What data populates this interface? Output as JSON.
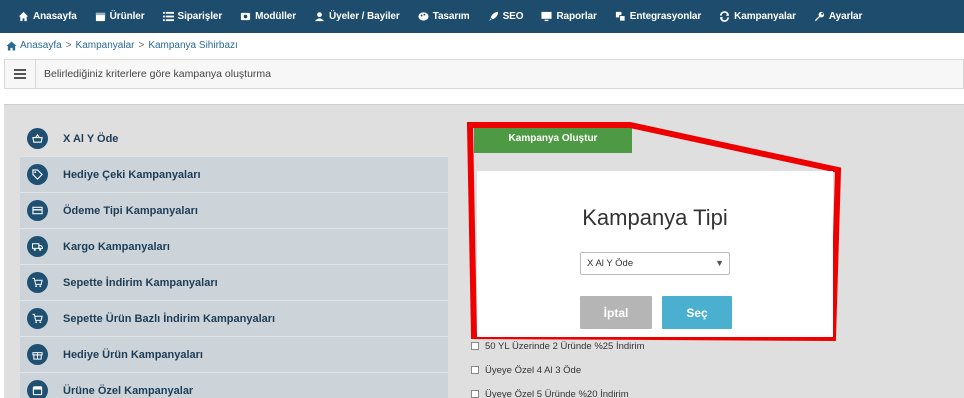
{
  "nav": {
    "items": [
      {
        "label": "Anasayfa",
        "icon": "home-icon"
      },
      {
        "label": "Ürünler",
        "icon": "box-icon"
      },
      {
        "label": "Siparişler",
        "icon": "list-icon"
      },
      {
        "label": "Modüller",
        "icon": "modules-icon"
      },
      {
        "label": "Üyeler / Bayiler",
        "icon": "user-icon"
      },
      {
        "label": "Tasarım",
        "icon": "palette-icon"
      },
      {
        "label": "SEO",
        "icon": "rocket-icon"
      },
      {
        "label": "Raporlar",
        "icon": "monitor-icon"
      },
      {
        "label": "Entegrasyonlar",
        "icon": "integration-icon"
      },
      {
        "label": "Kampanyalar",
        "icon": "refresh-icon"
      },
      {
        "label": "Ayarlar",
        "icon": "wrench-icon"
      }
    ]
  },
  "breadcrumb": {
    "home": "Anasayfa",
    "sep": ">",
    "level2": "Kampanyalar",
    "level3": "Kampanya Sihirbazı"
  },
  "infobar": {
    "text": "Belirlediğiniz kriterlere göre kampanya oluşturma"
  },
  "categories": [
    {
      "label": "X Al Y Öde",
      "icon": "basket-icon"
    },
    {
      "label": "Hediye Çeki Kampanyaları",
      "icon": "tag-icon"
    },
    {
      "label": "Ödeme Tipi Kampanyaları",
      "icon": "credit-card-icon"
    },
    {
      "label": "Kargo Kampanyaları",
      "icon": "truck-icon"
    },
    {
      "label": "Sepette İndirim Kampanyaları",
      "icon": "cart-icon"
    },
    {
      "label": "Sepette Ürün Bazlı İndirim Kampanyaları",
      "icon": "cart-icon"
    },
    {
      "label": "Hediye Ürün Kampanyaları",
      "icon": "gift-icon"
    },
    {
      "label": "Ürüne Özel Kampanyalar",
      "icon": "box-icon"
    }
  ],
  "create_button": "Kampanya Oluştur",
  "options": [
    "50 YL Üzerinde 2 Üründe %25 İndirim",
    "Üyeye Özel 4 Al 3 Öde",
    "Üyeye Özel 5 Üründe %20 İndirim"
  ],
  "modal": {
    "title": "Kampanya Tipi",
    "select_value": "X Al Y Öde",
    "cancel_label": "İptal",
    "ok_label": "Seç"
  },
  "colors": {
    "nav_bg": "#1d4c6d",
    "create_green": "#4e9a44",
    "highlight_red": "#ee0000",
    "ok_blue": "#4bafd0",
    "cancel_gray": "#b5b5b5"
  }
}
